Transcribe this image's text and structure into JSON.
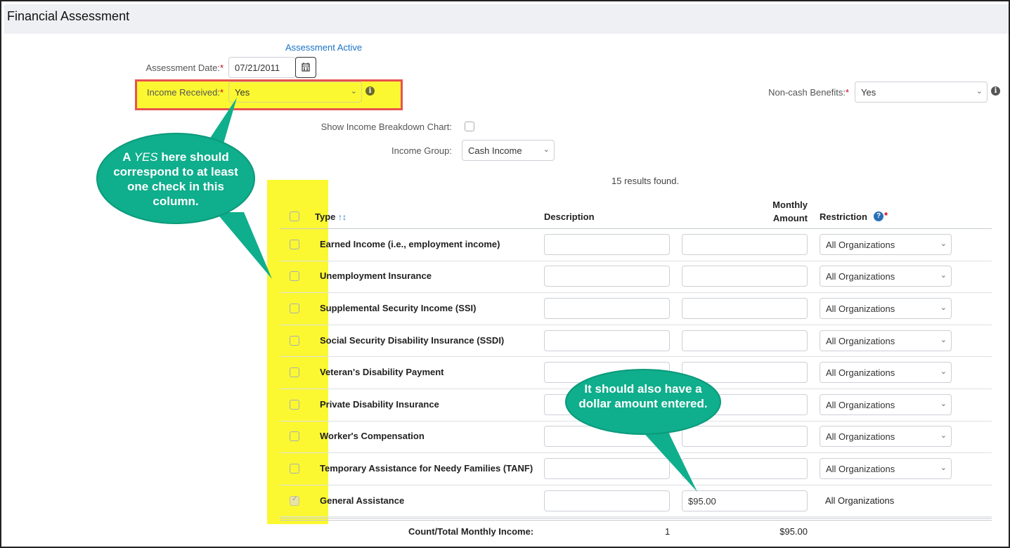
{
  "page_title": "Financial Assessment",
  "assessment_status": "Assessment Active",
  "assessment_date": {
    "label": "Assessment Date:",
    "value": "07/21/2011"
  },
  "income_received": {
    "label": "Income Received:",
    "value": "Yes"
  },
  "non_cash_benefits": {
    "label": "Non-cash Benefits:",
    "value": "Yes"
  },
  "show_chart": {
    "label": "Show Income Breakdown Chart:"
  },
  "income_group": {
    "label": "Income Group:",
    "value": "Cash Income"
  },
  "results_text": "15 results found.",
  "columns": {
    "type": "Type",
    "description": "Description",
    "monthly_line1": "Monthly",
    "monthly_line2": "Amount",
    "restriction": "Restriction"
  },
  "rows": [
    {
      "type": "Earned Income (i.e., employment income)",
      "amount": "",
      "restriction": "All Organizations",
      "checked": false
    },
    {
      "type": "Unemployment Insurance",
      "amount": "",
      "restriction": "All Organizations",
      "checked": false
    },
    {
      "type": "Supplemental Security Income (SSI)",
      "amount": "",
      "restriction": "All Organizations",
      "checked": false
    },
    {
      "type": "Social Security Disability Insurance (SSDI)",
      "amount": "",
      "restriction": "All Organizations",
      "checked": false
    },
    {
      "type": "Veteran's Disability Payment",
      "amount": "",
      "restriction": "All Organizations",
      "checked": false
    },
    {
      "type": "Private Disability Insurance",
      "amount": "",
      "restriction": "All Organizations",
      "checked": false
    },
    {
      "type": "Worker's Compensation",
      "amount": "",
      "restriction": "All Organizations",
      "checked": false
    },
    {
      "type": "Temporary Assistance for Needy Families (TANF)",
      "amount": "",
      "restriction": "All Organizations",
      "checked": false
    },
    {
      "type": "General Assistance",
      "amount": "$95.00",
      "restriction": "All Organizations",
      "checked": true
    }
  ],
  "footer": {
    "label": "Count/Total Monthly Income:",
    "count": "1",
    "total": "$95.00"
  },
  "callouts": {
    "yes_note": {
      "pre": "A ",
      "em": "YES",
      "post": " here should correspond to at least one check in this column."
    },
    "amount_note": "It should also have a dollar amount entered."
  },
  "colors": {
    "callout": "#0fae8c",
    "highlight": "#fbf832",
    "annotation_border": "#e8524f",
    "link": "#1a73c8",
    "required": "#d0021b"
  }
}
